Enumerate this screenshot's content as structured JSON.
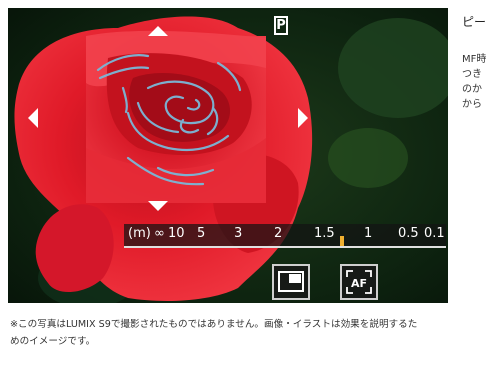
{
  "viewfinder": {
    "mode_badge": "P",
    "focus_scale": {
      "unit_label": "(m)",
      "ticks": [
        "∞",
        "10",
        "5",
        "3",
        "2",
        "1.5",
        "1",
        "0.5",
        "0.1"
      ],
      "current_position_fraction": 0.68,
      "marker_color": "#f0b030"
    },
    "buttons": {
      "window_icon": "window-frame-icon",
      "af_label": "AF"
    },
    "peaking_color": "#7ab8d8",
    "subject_color": "#e01a28"
  },
  "sidebar": {
    "title": "ピー",
    "body_lines": [
      "MF時",
      "つき",
      "のか",
      "から"
    ]
  },
  "caption": {
    "line1": "※この写真はLUMIX S9で撮影されたものではありません。画像・イラストは効果を説明するた",
    "line2": "めのイメージです。"
  }
}
